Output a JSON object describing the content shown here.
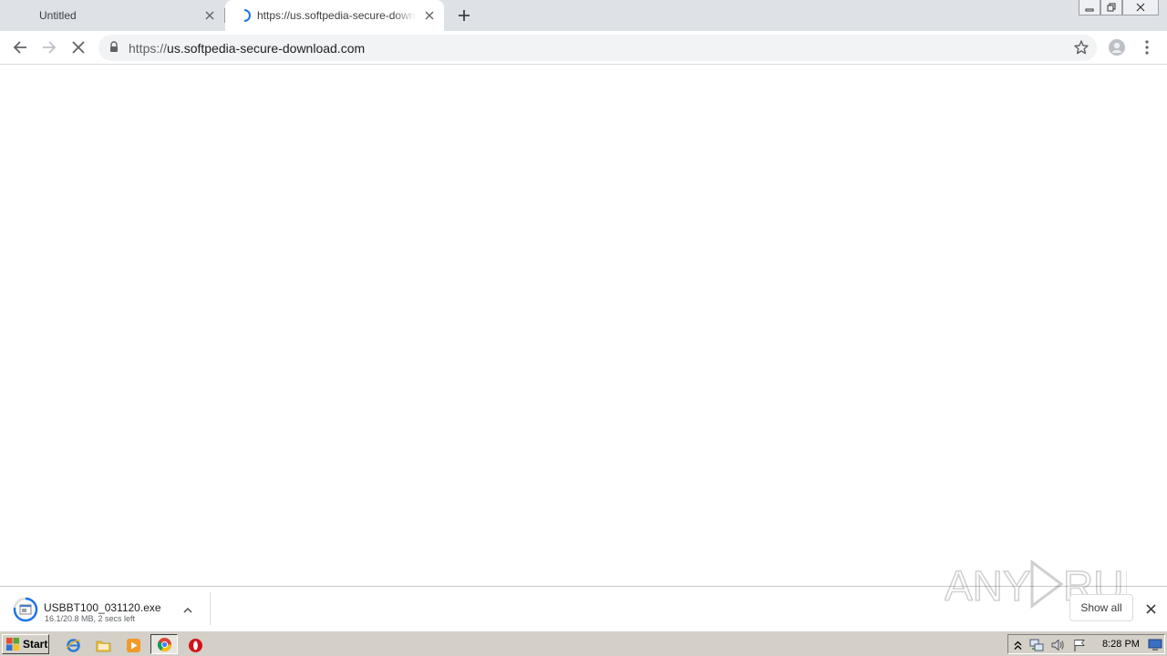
{
  "tabs": [
    {
      "title": "Untitled",
      "active": false
    },
    {
      "title": "https://us.softpedia-secure-download.com",
      "active": true,
      "loading": true
    }
  ],
  "toolbar": {
    "url_scheme": "https://",
    "url_host": "us.softpedia-secure-download.com"
  },
  "download": {
    "filename": "USBBT100_031120.exe",
    "status": "16.1/20.8 MB, 2 secs left",
    "progress_fraction": 0.774
  },
  "shelf": {
    "show_all_label": "Show all"
  },
  "watermark": {
    "text": "ANY RUN"
  },
  "taskbar": {
    "start_label": "Start",
    "quick_launch": [
      "internet-explorer-icon",
      "folder-icon",
      "media-player-icon",
      "chrome-icon",
      "opera-icon"
    ],
    "clock": "8:28 PM"
  },
  "colors": {
    "tab_strip": "#dee1e6",
    "omnibox": "#f1f3f4",
    "taskbar": "#d4d0c8",
    "accent_blue": "#1a73e8"
  }
}
